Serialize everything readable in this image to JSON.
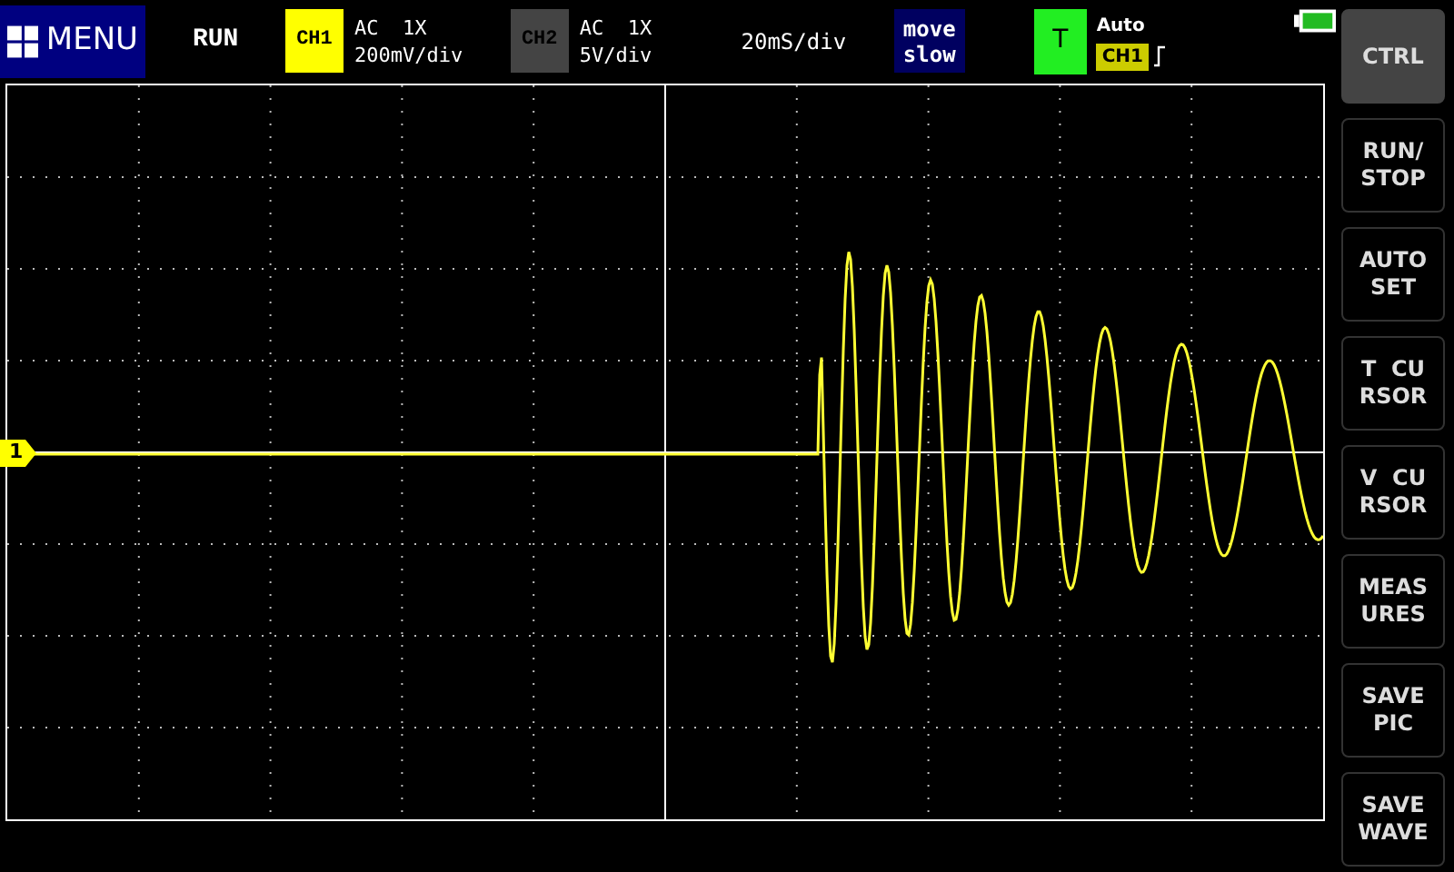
{
  "menu_button": {
    "label": "MENU"
  },
  "status": "RUN",
  "channels": [
    {
      "badge": "CH1",
      "selected": true,
      "coupling": "AC  1X",
      "scale": "200mV/div"
    },
    {
      "badge": "CH2",
      "selected": false,
      "coupling": "AC  1X",
      "scale": "5V/div"
    }
  ],
  "timebase": "20mS/div",
  "move_button": {
    "lines": [
      "move",
      "slow"
    ]
  },
  "trigger": {
    "badge": "T",
    "mode": "Auto",
    "source": "CH1"
  },
  "plot": {
    "channel_marker": "1"
  },
  "side_buttons": [
    {
      "lines": [
        "CTRL"
      ],
      "selected": true
    },
    {
      "lines": [
        "RUN/",
        "STOP"
      ],
      "selected": false
    },
    {
      "lines": [
        "AUTO",
        "SET"
      ],
      "selected": false
    },
    {
      "lines": [
        "T  CU",
        "RSOR"
      ],
      "selected": false
    },
    {
      "lines": [
        "V  CU",
        "RSOR"
      ],
      "selected": false
    },
    {
      "lines": [
        "MEAS",
        "URES"
      ],
      "selected": false
    },
    {
      "lines": [
        "SAVE",
        "PIC"
      ],
      "selected": false
    },
    {
      "lines": [
        "SAVE",
        "WAVE"
      ],
      "selected": false
    }
  ]
}
